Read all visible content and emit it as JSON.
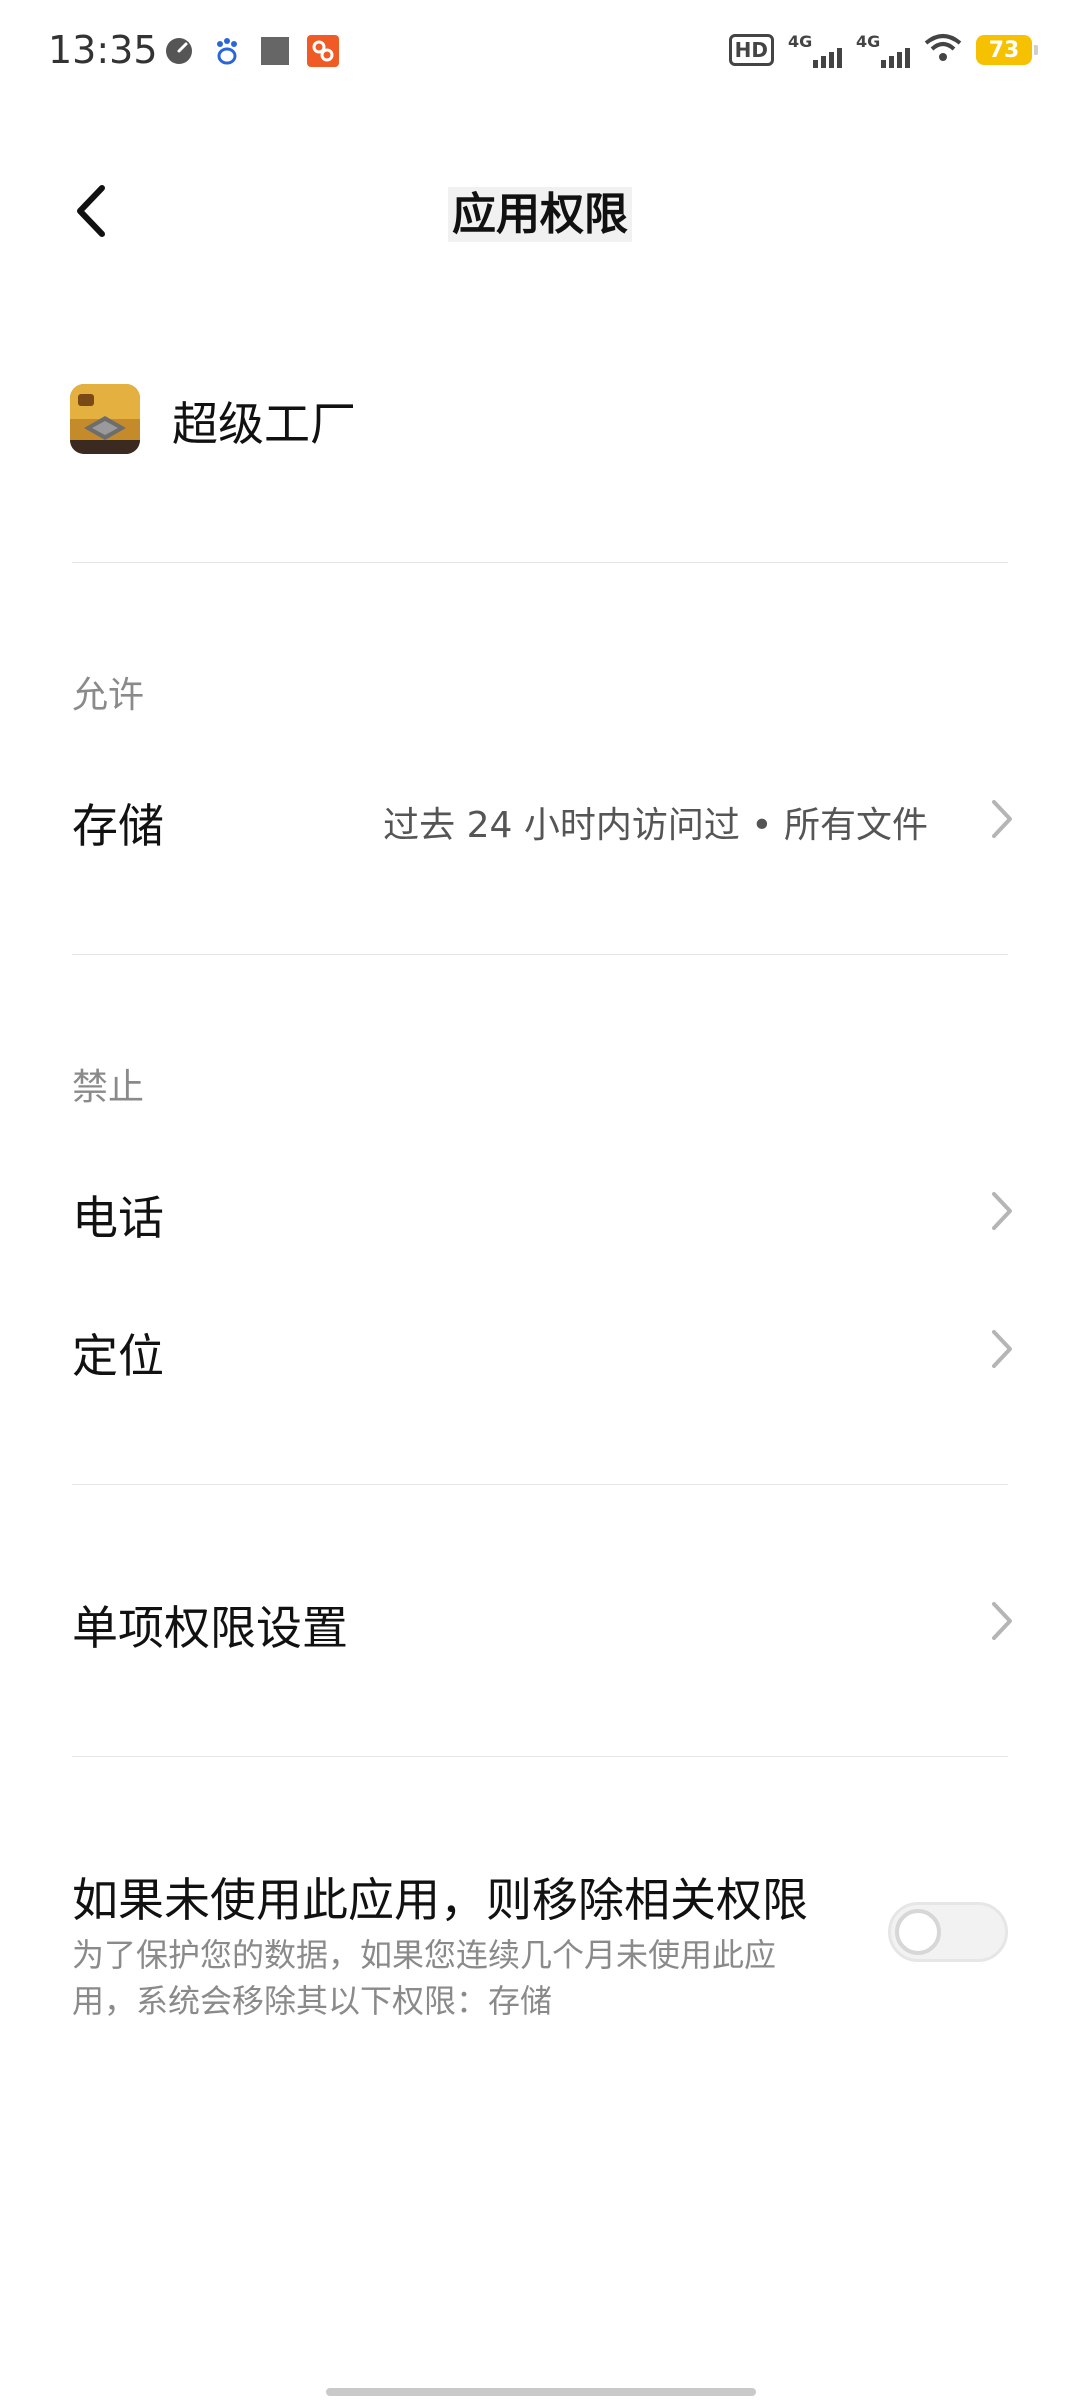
{
  "status_bar": {
    "time": "13:35",
    "hd_label": "HD",
    "sim1_label": "4G",
    "sim2_label": "4G",
    "battery": "73",
    "left_icons": [
      "speed-icon",
      "paw-icon",
      "square-icon",
      "app-badge-icon"
    ],
    "colors": {
      "battery": "#f6c100",
      "app_badge": "#f05a24"
    }
  },
  "header": {
    "title": "应用权限"
  },
  "app": {
    "name": "超级工厂",
    "icon": "app-icon"
  },
  "sections": {
    "allowed": {
      "label": "允许",
      "items": [
        {
          "label": "存储",
          "value": "过去 24 小时内访问过 • 所有文件"
        }
      ]
    },
    "denied": {
      "label": "禁止",
      "items": [
        {
          "label": "电话"
        },
        {
          "label": "定位"
        }
      ]
    }
  },
  "single_permission": {
    "label": "单项权限设置"
  },
  "auto_remove": {
    "title": "如果未使用此应用，则移除相关权限",
    "description": "为了保护您的数据，如果您连续几个月未使用此应用，系统会移除其以下权限：存储",
    "enabled": false
  }
}
